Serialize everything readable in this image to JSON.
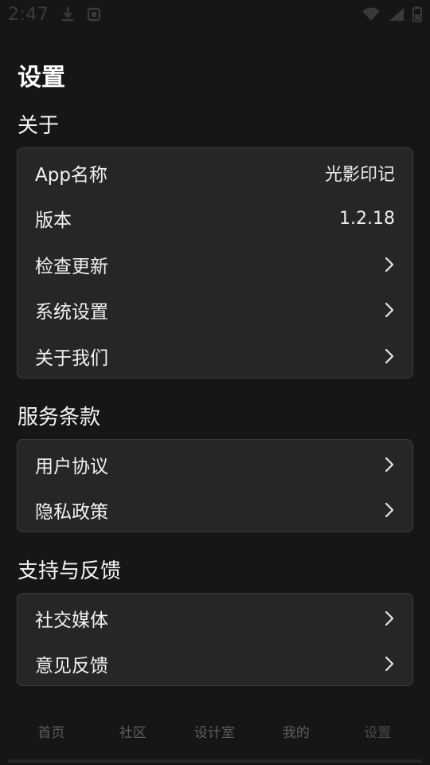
{
  "status_bar": {
    "time": "2:47",
    "left_icons": [
      "download-icon",
      "notification-app-icon"
    ],
    "right_icons": [
      "wifi-icon",
      "signal-icon",
      "battery-icon"
    ]
  },
  "page": {
    "title": "设置"
  },
  "sections": {
    "about": {
      "title": "关于",
      "rows": [
        {
          "label": "App名称",
          "value": "光影印记"
        },
        {
          "label": "版本",
          "value": "1.2.18"
        },
        {
          "label": "检查更新"
        },
        {
          "label": "系统设置"
        },
        {
          "label": "关于我们"
        }
      ]
    },
    "terms": {
      "title": "服务条款",
      "rows": [
        {
          "label": "用户协议"
        },
        {
          "label": "隐私政策"
        }
      ]
    },
    "support": {
      "title": "支持与反馈",
      "rows": [
        {
          "label": "社交媒体"
        },
        {
          "label": "意见反馈"
        }
      ]
    }
  },
  "bottom_nav": {
    "items": [
      {
        "label": "首页"
      },
      {
        "label": "社区"
      },
      {
        "label": "设计室"
      },
      {
        "label": "我的"
      },
      {
        "label": "设置"
      }
    ]
  },
  "colors": {
    "background": "#161616",
    "card": "#262626",
    "card_border": "#3c3c3c",
    "text": "#f2f2f2",
    "nav_text": "#5d5d5d"
  }
}
